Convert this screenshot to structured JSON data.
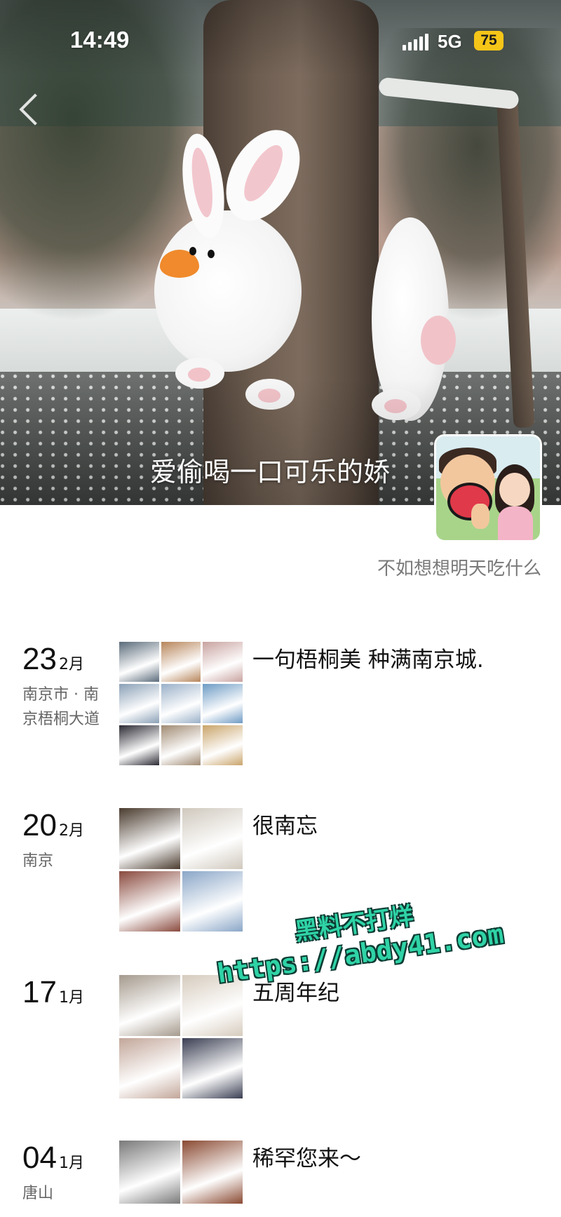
{
  "status_bar": {
    "time": "14:49",
    "network": "5G",
    "battery": "75"
  },
  "profile": {
    "name": "爱偷喝一口可乐的娇",
    "signature": "不如想想明天吃什么"
  },
  "posts": [
    {
      "day": "23",
      "month": "2月",
      "location": "南京市 · 南京梧桐大道",
      "text": "一句梧桐美 种满南京城.",
      "thumb_colors": [
        "#5a6b7a",
        "#b7855a",
        "#c8a3a0",
        "#8aa0b6",
        "#9ab0c8",
        "#6d9bc4",
        "#2b2a33",
        "#a08a72",
        "#c9a46a"
      ]
    },
    {
      "day": "20",
      "month": "2月",
      "location": "南京",
      "text": "很南忘",
      "thumb_colors": [
        "#4a3b2e",
        "#cfc8bd",
        "#8a4a3e",
        "#8aa6c7"
      ]
    },
    {
      "day": "17",
      "month": "1月",
      "location": "",
      "text": "五周年纪",
      "thumb_colors": [
        "#a59a8d",
        "#d6cbbd",
        "#c2a699",
        "#3a3e52"
      ]
    },
    {
      "day": "04",
      "month": "1月",
      "location": "唐山",
      "text": "稀罕您来～",
      "thumb_colors": [
        "#7a7a7a",
        "#8a4a32"
      ]
    }
  ],
  "watermark": {
    "line1": "黑料不打烊",
    "line2": "https://abdy41.com"
  }
}
